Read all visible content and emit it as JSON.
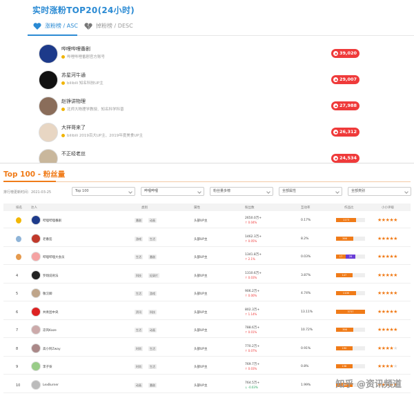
{
  "top": {
    "title": "实时涨粉TOP20(24小时)",
    "tabs": [
      {
        "label": "涨粉榜 / ASC",
        "icon": "heart-icon"
      },
      {
        "label": "掉粉榜 / DESC",
        "icon": "broken-heart-icon"
      }
    ],
    "items": [
      {
        "name": "哔哩哔哩番剧",
        "desc": "哔哩哔哩番剧官方账号",
        "badge": "39,020"
      },
      {
        "name": "苏星河牛通",
        "desc": "bilibili 知名科技UP主",
        "badge": "29,007"
      },
      {
        "name": "赵铮讲物理",
        "desc": "北师大物理学教授、知名科学科普",
        "badge": "27,988"
      },
      {
        "name": "大祥哥来了",
        "desc": "bilibili 2019百大UP主、2019年度美食UP主",
        "badge": "26,312"
      },
      {
        "name": "不正经老丝",
        "desc": "",
        "badge": "24,534"
      }
    ]
  },
  "bottom": {
    "title": "Top 100 - 粉丝量",
    "update_label": "排行榜更新时间：2021-03-25",
    "selects": [
      "Top 100",
      "哔哩哔哩",
      "粉丝量多榜",
      "全部属性",
      "全部类别"
    ],
    "headers": [
      "排名",
      "达人",
      "类别",
      "属性",
      "粉丝数",
      "互动率",
      "作品比",
      "小小评级"
    ],
    "rows": [
      {
        "rank": "1",
        "medal": "gold",
        "name": "哔哩哔哩番剧",
        "tags": [
          "番剧",
          "动画"
        ],
        "level": "头部UP主",
        "fans": "2650.0万+",
        "delta": "↑ 0.04%",
        "rate": "0.17%",
        "bar": "1173",
        "stars": 5
      },
      {
        "rank": "2",
        "medal": "silver",
        "name": "老番茄",
        "tags": [
          "游戏",
          "生活"
        ],
        "level": "头部UP主",
        "fans": "1462.3万+",
        "delta": "↑ 0.05%",
        "rate": "8.2%",
        "bar": "366",
        "stars": 5
      },
      {
        "rank": "3",
        "medal": "bronze",
        "name": "哔哩哔哩大会员",
        "tags": [
          "生活",
          "番剧"
        ],
        "level": "头部UP主",
        "fans": "1341.8万+",
        "delta": "↑ 2.1%",
        "rate": "0.03%",
        "bar": "17",
        "bar2": "28",
        "stars": 5
      },
      {
        "rank": "4",
        "medal": "",
        "name": "罗翔说刑法",
        "tags": [
          "科技",
          "纪录片"
        ],
        "level": "头部UP主",
        "fans": "1310.6万+",
        "delta": "↑ 0.03%",
        "rate": "3.87%",
        "bar": "147",
        "stars": 5
      },
      {
        "rank": "5",
        "medal": "",
        "name": "敬汉卿",
        "tags": [
          "生活",
          "游戏"
        ],
        "level": "头部UP主",
        "fans": "906.2万+",
        "delta": "↑ 0.00%",
        "rate": "4.74%",
        "bar": "1106",
        "stars": 5
      },
      {
        "rank": "6",
        "medal": "",
        "name": "共青团中央",
        "tags": [
          "资讯",
          "科技"
        ],
        "level": "头部UP主",
        "fans": "802.3万+",
        "delta": "↑ 1.14%",
        "rate": "13.11%",
        "bar": "3737",
        "stars": 5
      },
      {
        "rank": "7",
        "medal": "",
        "name": "凉风Kaze",
        "tags": [
          "生活",
          "动画"
        ],
        "level": "头部UP主",
        "fans": "788.6万+",
        "delta": "↑ 0.01%",
        "rate": "10.72%",
        "bar": "398",
        "stars": 5
      },
      {
        "rank": "8",
        "medal": "",
        "name": "高小阿Zway",
        "tags": [
          "时尚",
          "生活"
        ],
        "level": "头部UP主",
        "fans": "770.2万+",
        "delta": "↑ 0.07%",
        "rate": "0.91%",
        "bar": "190",
        "stars": 4
      },
      {
        "rank": "9",
        "medal": "",
        "name": "李子柒",
        "tags": [
          "时尚",
          "生活"
        ],
        "level": "头部UP主",
        "fans": "769.7万+",
        "delta": "↑ 0.03%",
        "rate": "0.8%",
        "bar": "138",
        "stars": 4
      },
      {
        "rank": "10",
        "medal": "",
        "name": "LexBurner",
        "tags": [
          "动画",
          "番剧"
        ],
        "level": "头部UP主",
        "fans": "764.5万+",
        "delta": "↓ -0.03%",
        "rate": "1.99%",
        "bar": "266",
        "stars": 5
      }
    ]
  },
  "watermark": "知乎 @资讯频道",
  "colors": {
    "accent_blue": "#2a8ad3",
    "accent_orange": "#f07b18",
    "badge_red": "#ef3a3a"
  }
}
